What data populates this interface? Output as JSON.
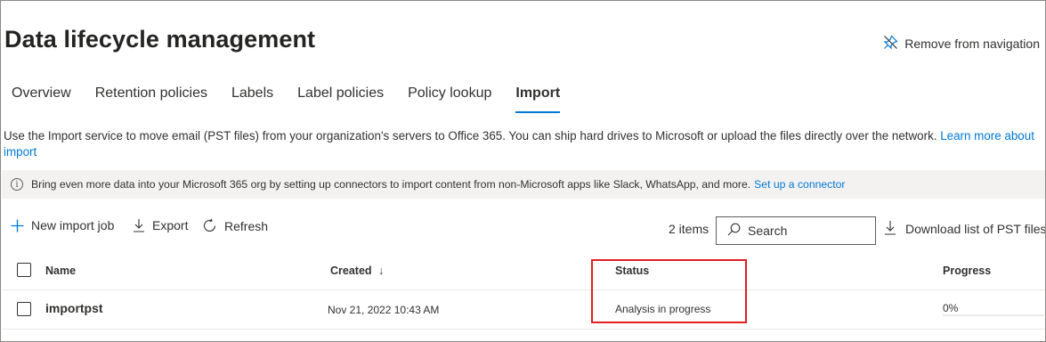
{
  "page": {
    "title": "Data lifecycle management",
    "remove_nav_label": "Remove from navigation"
  },
  "tabs": [
    {
      "label": "Overview",
      "active": false
    },
    {
      "label": "Retention policies",
      "active": false
    },
    {
      "label": "Labels",
      "active": false
    },
    {
      "label": "Label policies",
      "active": false
    },
    {
      "label": "Policy lookup",
      "active": false
    },
    {
      "label": "Import",
      "active": true
    }
  ],
  "description": {
    "text": "Use the Import service to move email (PST files) from your organization's servers to Office 365. You can ship hard drives to Microsoft or upload the files directly over the network.",
    "link": "Learn more about import"
  },
  "banner": {
    "icon": "info-icon",
    "text": "Bring even more data into your Microsoft 365 org by setting up connectors to import content from non-Microsoft apps like Slack, WhatsApp, and more.",
    "link": "Set up a connector"
  },
  "toolbar": {
    "new_import_label": "New import job",
    "export_label": "Export",
    "refresh_label": "Refresh",
    "item_count": "2 items",
    "search_placeholder": "Search",
    "download_label": "Download list of PST files"
  },
  "table": {
    "columns": {
      "name": "Name",
      "created": "Created",
      "created_sort": "↓",
      "status": "Status",
      "progress": "Progress"
    },
    "rows": [
      {
        "name": "importpst",
        "created": "Nov 21, 2022 10:43 AM",
        "status": "Analysis in progress",
        "progress_label": "0%",
        "progress_fraction": 0
      }
    ]
  },
  "colors": {
    "accent": "#0078d4",
    "highlight": "#e01e24",
    "banner_bg": "#f3f2f1"
  }
}
